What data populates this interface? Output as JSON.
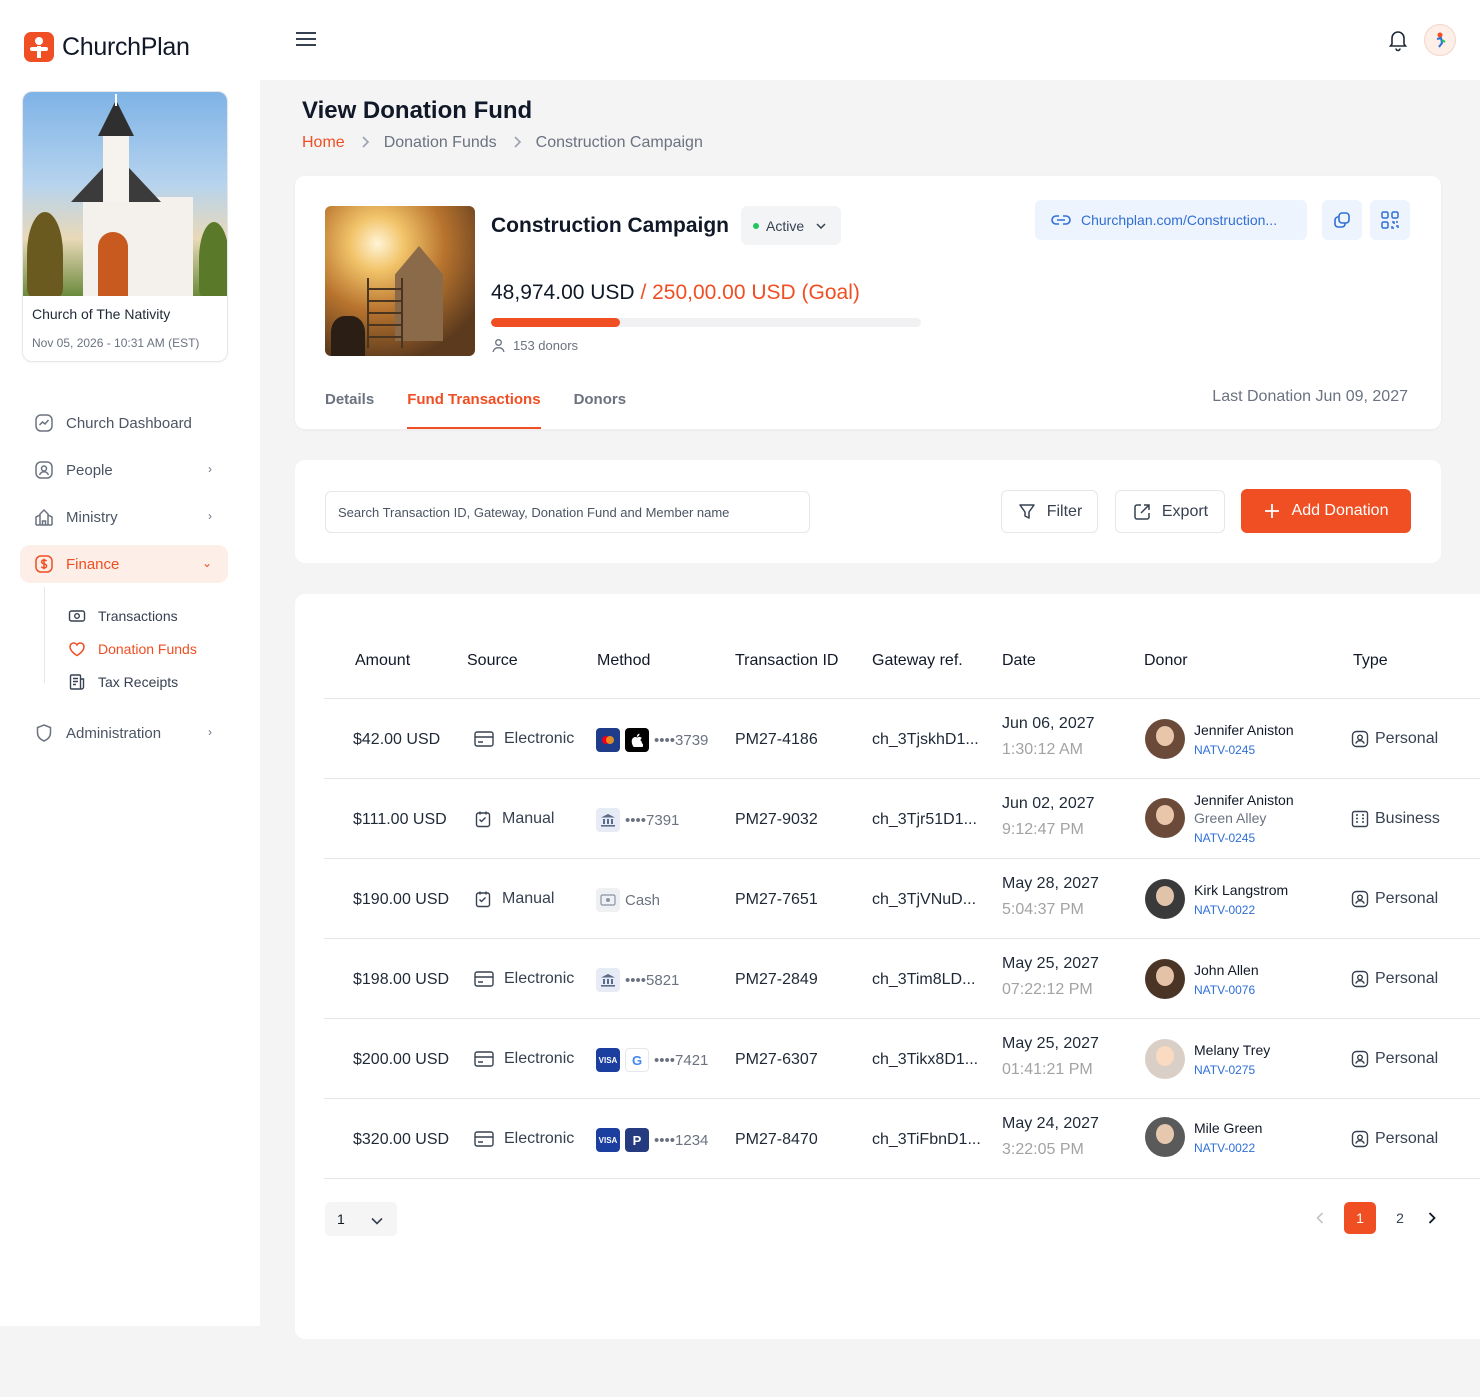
{
  "app": {
    "name": "ChurchPlan"
  },
  "church": {
    "name": "Church of The Nativity",
    "datetime": "Nov 05, 2026 - 10:31 AM (EST)"
  },
  "nav": {
    "dashboard": "Church Dashboard",
    "people": "People",
    "ministry": "Ministry",
    "finance": "Finance",
    "sub": {
      "transactions": "Transactions",
      "donation_funds": "Donation Funds",
      "tax_receipts": "Tax Receipts"
    },
    "administration": "Administration"
  },
  "page": {
    "title": "View Donation Fund",
    "breadcrumb": [
      "Home",
      "Donation Funds",
      "Construction Campaign"
    ]
  },
  "fund": {
    "name": "Construction Campaign",
    "status": "Active",
    "link": "Churchplan.com/Construction...",
    "raised": "48,974.00 USD",
    "goal": "/ 250,00.00 USD (Goal)",
    "progress": 0.3,
    "donors": "153 donors",
    "tabs": [
      "Details",
      "Fund Transactions",
      "Donors"
    ],
    "last_donation": "Last Donation Jun 09, 2027"
  },
  "toolbar": {
    "search_placeholder": "Search Transaction ID, Gateway, Donation Fund and Member name",
    "filter": "Filter",
    "export": "Export",
    "add": "Add Donation"
  },
  "table": {
    "headers": [
      "Amount",
      "Source",
      "Method",
      "Transaction ID",
      "Gateway ref.",
      "Date",
      "Donor",
      "Type"
    ],
    "rows": [
      {
        "amount": "$42.00 USD",
        "source": "Electronic",
        "method": "••••3739",
        "txn": "PM27-4186",
        "gateway": "ch_3TjskhD1...",
        "date": "Jun 06, 2027",
        "time": "1:30:12 AM",
        "donor": "Jennifer Aniston",
        "donor_sub": "",
        "donor_id": "NATV-0245",
        "type": "Personal"
      },
      {
        "amount": "$111.00 USD",
        "source": "Manual",
        "method": "••••7391",
        "txn": "PM27-9032",
        "gateway": "ch_3Tjr51D1...",
        "date": "Jun 02, 2027",
        "time": "9:12:47 PM",
        "donor": "Jennifer Aniston",
        "donor_sub": "Green Alley",
        "donor_id": "NATV-0245",
        "type": "Business"
      },
      {
        "amount": "$190.00 USD",
        "source": "Manual",
        "method": "Cash",
        "txn": "PM27-7651",
        "gateway": "ch_3TjVNuD...",
        "date": "May 28, 2027",
        "time": "5:04:37 PM",
        "donor": "Kirk Langstrom",
        "donor_sub": "",
        "donor_id": "NATV-0022",
        "type": "Personal"
      },
      {
        "amount": "$198.00 USD",
        "source": "Electronic",
        "method": "••••5821",
        "txn": "PM27-2849",
        "gateway": "ch_3Tim8LD...",
        "date": "May 25, 2027",
        "time": "07:22:12 PM",
        "donor": "John Allen",
        "donor_sub": "",
        "donor_id": "NATV-0076",
        "type": "Personal"
      },
      {
        "amount": "$200.00 USD",
        "source": "Electronic",
        "method": "••••7421",
        "txn": "PM27-6307",
        "gateway": "ch_3Tikx8D1...",
        "date": "May 25, 2027",
        "time": "01:41:21 PM",
        "donor": "Melany Trey",
        "donor_sub": "",
        "donor_id": "NATV-0275",
        "type": "Personal"
      },
      {
        "amount": "$320.00 USD",
        "source": "Electronic",
        "method": "••••1234",
        "txn": "PM27-8470",
        "gateway": "ch_3TiFbnD1...",
        "date": "May 24, 2027",
        "time": "3:22:05 PM",
        "donor": "Mile Green",
        "donor_sub": "",
        "donor_id": "NATV-0022",
        "type": "Personal"
      }
    ]
  },
  "pagination": {
    "per_page": "1",
    "pages": [
      "1",
      "2"
    ],
    "current": "1"
  },
  "colors": {
    "accent": "#f04e23",
    "link": "#2f6fd6",
    "status_active": "#22c55e"
  }
}
